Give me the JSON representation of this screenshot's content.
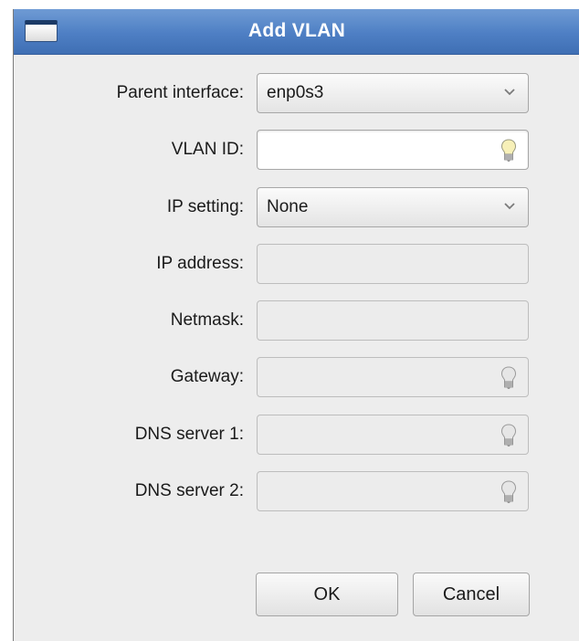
{
  "window": {
    "title": "Add VLAN"
  },
  "form": {
    "parent_interface": {
      "label": "Parent interface:",
      "value": "enp0s3"
    },
    "vlan_id": {
      "label": "VLAN ID:",
      "value": ""
    },
    "ip_setting": {
      "label": "IP setting:",
      "value": "None"
    },
    "ip_address": {
      "label": "IP address:",
      "value": ""
    },
    "netmask": {
      "label": "Netmask:",
      "value": ""
    },
    "gateway": {
      "label": "Gateway:",
      "value": ""
    },
    "dns1": {
      "label": "DNS server 1:",
      "value": ""
    },
    "dns2": {
      "label": "DNS server 2:",
      "value": ""
    }
  },
  "buttons": {
    "ok": "OK",
    "cancel": "Cancel"
  },
  "icons": {
    "hint": "lightbulb-icon",
    "dropdown": "chevron-down-icon"
  },
  "colors": {
    "titlebar": "#4e7fc4",
    "window_bg": "#ededed",
    "title_text": "#ffffff"
  }
}
